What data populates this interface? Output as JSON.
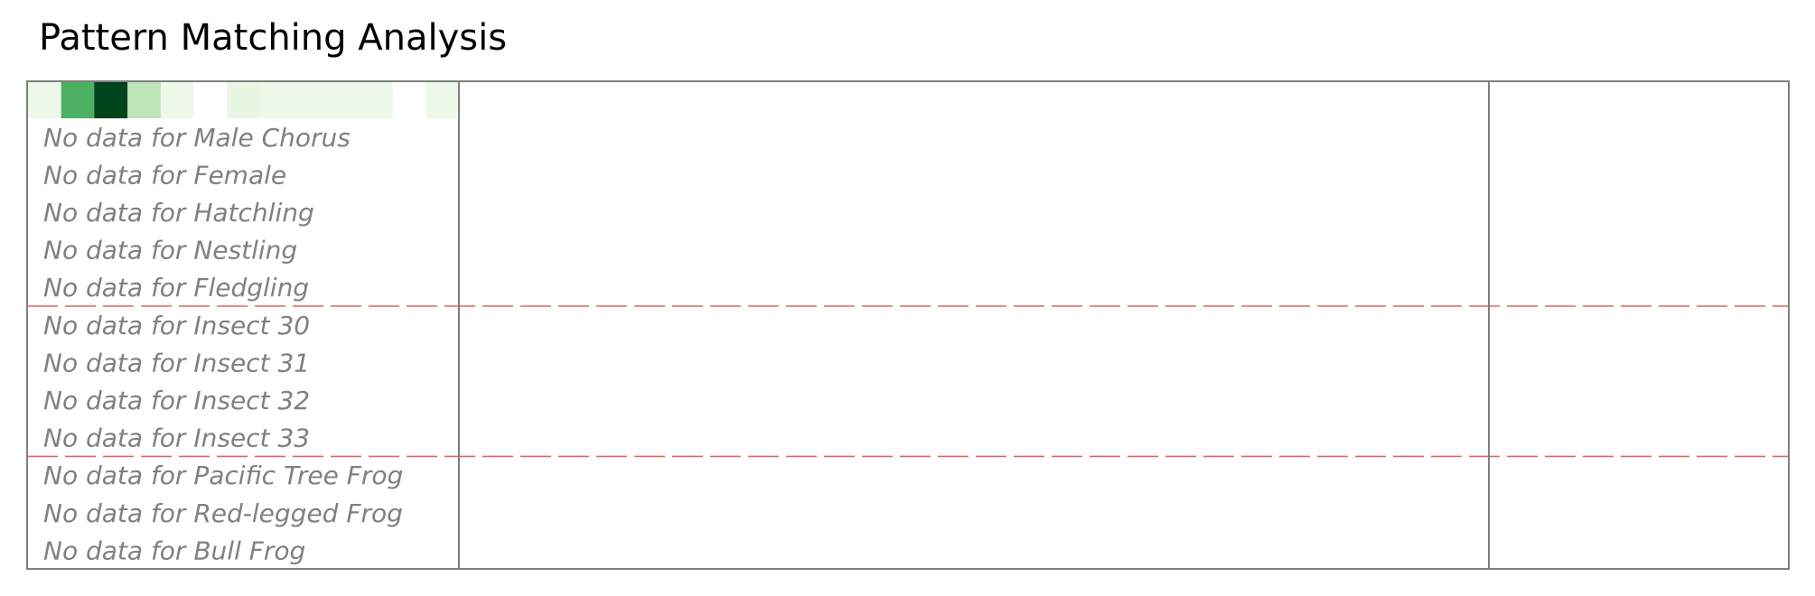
{
  "title": "Pattern Matching Analysis",
  "colors": {
    "frame": "#7f7f7f",
    "placeholder_text": "#808080",
    "group_divider": "#e06666",
    "heatmap_scale": [
      "#f7fcf5",
      "#e5f5e0",
      "#c7e9c0",
      "#a1d99b",
      "#74c476",
      "#41ab5d",
      "#238b45",
      "#006d2c",
      "#00441b"
    ]
  },
  "chart_data": {
    "type": "heatmap",
    "title": "Pattern Matching Analysis",
    "heatmap_row": {
      "cells": [
        0.07,
        0.6,
        1.0,
        0.28,
        0.07,
        0.0,
        0.1,
        0.07,
        0.07,
        0.07,
        0.07,
        0.0,
        0.07
      ]
    },
    "rows": [
      {
        "label": "Male Chorus",
        "group": 0
      },
      {
        "label": "Female",
        "group": 0
      },
      {
        "label": "Hatchling",
        "group": 0
      },
      {
        "label": "Nestling",
        "group": 0
      },
      {
        "label": "Fledgling",
        "group": 0
      },
      {
        "label": "Insect 30",
        "group": 1
      },
      {
        "label": "Insect 31",
        "group": 1
      },
      {
        "label": "Insect 32",
        "group": 1
      },
      {
        "label": "Insect 33",
        "group": 1
      },
      {
        "label": "Pacific Tree Frog",
        "group": 2
      },
      {
        "label": "Red-legged Frog",
        "group": 2
      },
      {
        "label": "Bull Frog",
        "group": 2
      }
    ],
    "placeholder_prefix": "No data for",
    "group_dividers_after_rows": [
      5,
      9
    ],
    "panels": 3,
    "grid": false,
    "legend": "none"
  }
}
